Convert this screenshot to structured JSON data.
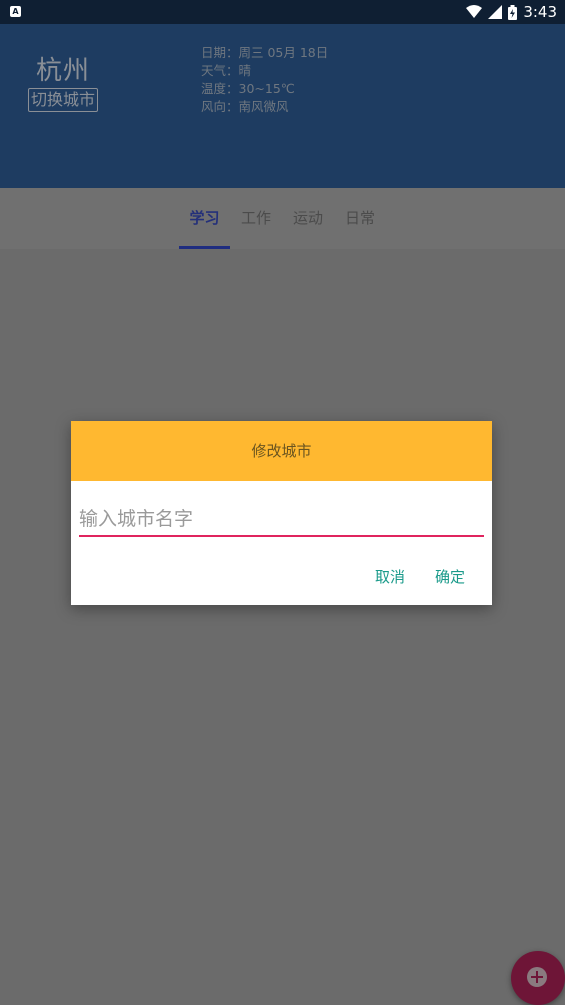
{
  "status_bar": {
    "time": "3:43",
    "app_icon_letter": "A"
  },
  "header": {
    "city": "杭州",
    "switch_city_label": "切换城市",
    "weather": {
      "date": "日期：周三 05月 18日",
      "condition": "天气：晴",
      "temperature": "温度：30~15℃",
      "wind": "风向：南风微风"
    }
  },
  "tabs": [
    {
      "label": "学习",
      "active": true
    },
    {
      "label": "工作",
      "active": false
    },
    {
      "label": "运动",
      "active": false
    },
    {
      "label": "日常",
      "active": false
    }
  ],
  "dialog": {
    "title": "修改城市",
    "input_placeholder": "输入城市名字",
    "input_value": "",
    "cancel_label": "取消",
    "confirm_label": "确定"
  },
  "colors": {
    "header_bg": "#1e3c61",
    "dialog_header": "#ffb830",
    "input_underline": "#e0245e",
    "button_text": "#1a9a8a",
    "fab": "#6e1537"
  },
  "fab": {
    "icon": "add-circle-icon"
  }
}
